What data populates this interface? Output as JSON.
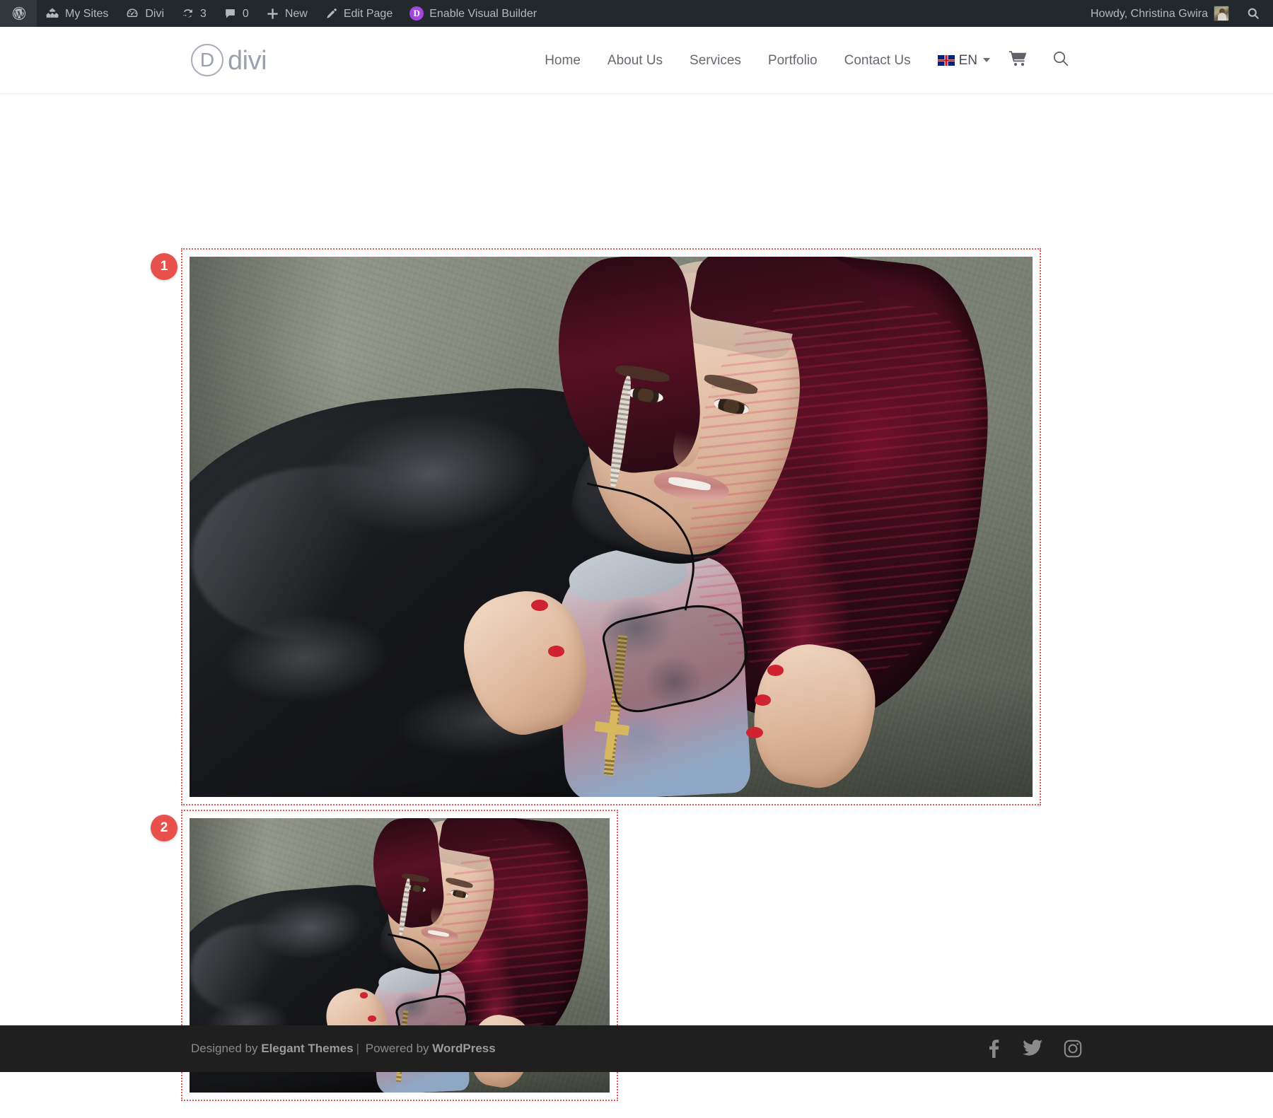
{
  "adminbar": {
    "left_items": [
      {
        "icon": "wordpress-logo-icon",
        "label": ""
      },
      {
        "icon": "my-sites-icon",
        "label": "My Sites"
      },
      {
        "icon": "divi-dashboard-icon",
        "label": "Divi"
      },
      {
        "icon": "updates-icon",
        "label": "3"
      },
      {
        "icon": "comments-icon",
        "label": "0"
      },
      {
        "icon": "plus-icon",
        "label": "New"
      },
      {
        "icon": "pencil-icon",
        "label": "Edit Page"
      },
      {
        "icon": "divi-visual-builder-icon",
        "label": "Enable Visual Builder"
      }
    ],
    "greeting": "Howdy, Christina Gwira",
    "avatar_alt": "user-avatar",
    "search_icon": "search-icon"
  },
  "header": {
    "logo": {
      "mark": "D",
      "text": "divi"
    },
    "nav": [
      {
        "label": "Home"
      },
      {
        "label": "About Us"
      },
      {
        "label": "Services"
      },
      {
        "label": "Portfolio"
      },
      {
        "label": "Contact Us"
      }
    ],
    "language": {
      "flag": "uk-flag-icon",
      "code": "EN",
      "chevron": "chevron-down-icon"
    },
    "cart_icon": "shopping-cart-icon",
    "search_icon": "search-icon"
  },
  "builder": {
    "markers": [
      {
        "number": "1"
      },
      {
        "number": "2"
      }
    ],
    "modules": [
      {
        "name": "image-module-fullwidth",
        "alt": "Woman with red hair in leather jacket holding sunglasses"
      },
      {
        "name": "image-module-small",
        "alt": "Woman with red hair in leather jacket holding sunglasses"
      }
    ],
    "outline_color": "#e5594e",
    "marker_color": "#e8514b"
  },
  "footer": {
    "credit_prefix": "Designed by ",
    "credit_brand": "Elegant Themes",
    "credit_sep": "|",
    "credit_middle": " Powered by ",
    "credit_platform": "WordPress",
    "social": [
      {
        "name": "facebook-icon"
      },
      {
        "name": "twitter-icon"
      },
      {
        "name": "instagram-icon"
      }
    ]
  }
}
